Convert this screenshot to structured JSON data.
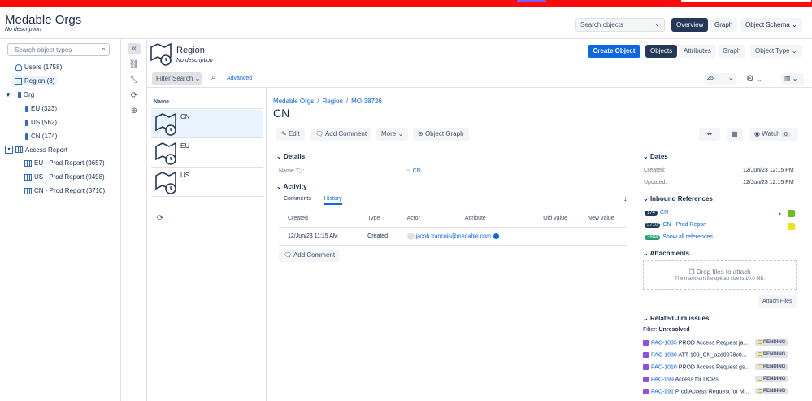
{
  "header": {
    "title": "Medable Orgs",
    "description": "No description",
    "search_placeholder": "Search objects",
    "tabs": [
      "Overview",
      "Graph"
    ],
    "schema_button": "Object Schema"
  },
  "sidebar": {
    "search_placeholder": "Search object types",
    "items": [
      {
        "label": "Users (1758)"
      },
      {
        "label": "Region (3)"
      },
      {
        "label": "Org"
      },
      {
        "label": "EU (323)"
      },
      {
        "label": "US (562)"
      },
      {
        "label": "CN (174)"
      },
      {
        "label": "Access Report"
      },
      {
        "label": "EU - Prod Report (9657)"
      },
      {
        "label": "US - Prod Report (9498)"
      },
      {
        "label": "CN - Prod Report (3710)"
      }
    ]
  },
  "region": {
    "title": "Region",
    "description": "No description",
    "create_button": "Create Object",
    "view_tabs": [
      "Objects",
      "Attributes",
      "Graph"
    ],
    "object_type_button": "Object Type"
  },
  "filterbar": {
    "filter_search": "Filter Search",
    "advanced": "Advanced",
    "page_size": "25"
  },
  "list": {
    "header": "Name",
    "rows": [
      "CN",
      "EU",
      "US"
    ]
  },
  "detail": {
    "breadcrumb": [
      "Medable Orgs",
      "Region",
      "MO-38726"
    ],
    "title": "CN",
    "actions": {
      "edit": "Edit",
      "add_comment": "Add Comment",
      "more": "More",
      "object_graph": "Object Graph",
      "watch": "Watch",
      "watch_count": "0"
    },
    "details_heading": "Details",
    "name_label": "Name",
    "name_value": "CN",
    "activity_heading": "Activity",
    "activity_tabs": [
      "Comments",
      "History"
    ],
    "history_columns": [
      "Created",
      "Type",
      "Actor",
      "Attribute",
      "Old value",
      "New value"
    ],
    "history_rows": [
      {
        "created": "12/Jun/23 11:15 AM",
        "type": "Created",
        "actor": "jacob.francois@medable.com"
      }
    ],
    "add_comment_bottom": "Add Comment"
  },
  "right": {
    "dates_heading": "Dates",
    "created_label": "Created:",
    "created_value": "12/Jun/23 12:15 PM",
    "updated_label": "Updated:",
    "updated_value": "12/Jun/23 12:15 PM",
    "inbound_heading": "Inbound References",
    "inbound": [
      {
        "count": "174",
        "label": "CN"
      },
      {
        "count": "3710",
        "label": "CN - Prod Report"
      },
      {
        "count": "3884",
        "label": "Show all references"
      }
    ],
    "attachments_heading": "Attachments",
    "drop_text": "Drop files to attach",
    "max_size_text": "The maximum file upload size is 10.0 MB.",
    "attach_button": "Attach Files",
    "jira_heading": "Related Jira issues",
    "filter_label": "Filter:",
    "filter_value": "Unresolved",
    "jira_issues": [
      {
        "key": "PAC-1035",
        "summary": "PROD Access Request ja...",
        "status": "PENDING"
      },
      {
        "key": "PAC-1030",
        "summary": "ATT-109_CN_azd9078c0...",
        "status": "PENDING"
      },
      {
        "key": "PAC-1010",
        "summary": "PROD Access Request gs...",
        "status": "PENDING"
      },
      {
        "key": "PAC-999",
        "summary": "Access for DCRs",
        "status": "PENDING"
      },
      {
        "key": "PAC-991",
        "summary": "Prod Access Request for M...",
        "status": "PENDING"
      }
    ]
  },
  "colors": {
    "primary": "#0c66e4",
    "dark": "#253858",
    "topbar": "#ff0b0b",
    "pending": "#e2b203",
    "jira": "#904ee2"
  }
}
